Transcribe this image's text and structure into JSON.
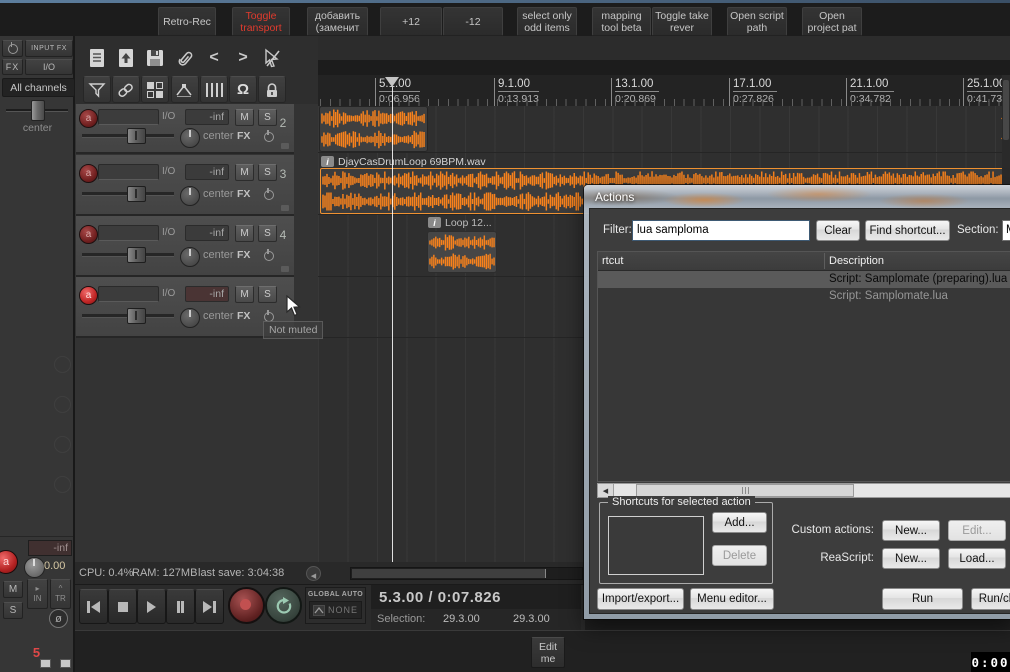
{
  "top_toolbar": {
    "buttons": [
      {
        "label": "Retro-Rec"
      },
      {
        "label": "Toggle transport"
      },
      {
        "label": "добавить (заменит"
      },
      {
        "label": "+12"
      },
      {
        "label": "-12"
      },
      {
        "label": "select only odd items"
      },
      {
        "label": "mapping tool beta"
      },
      {
        "label": "Toggle take rever"
      },
      {
        "label": "Open script path"
      },
      {
        "label": "Open project pat"
      }
    ]
  },
  "icons": {
    "undo": "<",
    "redo": ">",
    "magnet": "Ω",
    "rec_arm": "a",
    "info_badge": "i",
    "scroll_left": "◀",
    "monitor_play": "▸",
    "track_mode_caret": "^",
    "phase": "ø"
  },
  "sidebar": {
    "input_fx": "INPUT FX",
    "fx": "FX",
    "io": "I/O",
    "all_channels": "All channels",
    "pan": "center",
    "master": {
      "vol": "-inf",
      "pan_val": "0.00",
      "mute": "M",
      "solo": "S",
      "monitor": "IN",
      "track_mode": "TR",
      "number": "5"
    }
  },
  "ruler": {
    "marks": [
      {
        "beat": "5.1.00",
        "time": "0:06.956"
      },
      {
        "beat": "9.1.00",
        "time": "0:13.913"
      },
      {
        "beat": "13.1.00",
        "time": "0:20.869"
      },
      {
        "beat": "17.1.00",
        "time": "0:27.826"
      },
      {
        "beat": "21.1.00",
        "time": "0:34.782"
      },
      {
        "beat": "25.1.00",
        "time": "0:41.739"
      }
    ]
  },
  "tracks": [
    {
      "number": "2",
      "io": "I/O",
      "vol": "-inf",
      "pan": "center",
      "mute": "M",
      "solo": "S",
      "fx": "FX"
    },
    {
      "number": "3",
      "io": "I/O",
      "vol": "-inf",
      "pan": "center",
      "mute": "M",
      "solo": "S",
      "fx": "FX"
    },
    {
      "number": "4",
      "io": "I/O",
      "vol": "-inf",
      "pan": "center",
      "mute": "M",
      "solo": "S",
      "fx": "FX"
    },
    {
      "number": "",
      "io": "I/O",
      "vol": "-inf",
      "pan": "center",
      "mute": "M",
      "solo": "S",
      "fx": "FX"
    }
  ],
  "arrange": {
    "item1_label": "DjayCasDrumLoop 69BPM.wav",
    "item2_label": "Loop 12...",
    "wave_color": "#f8821c",
    "selected_border": "#ef9232"
  },
  "tooltip": "Not muted",
  "actions": {
    "title": "Actions",
    "filter_label": "Filter:",
    "filter_value": "lua samploma",
    "clear": "Clear",
    "find_shortcut": "Find shortcut...",
    "section_label": "Section:",
    "section_value": "Ma",
    "col_shortcut": "rtcut",
    "col_description": "Description",
    "rows": [
      {
        "description": "Script: Samplomate (preparing).lua",
        "selected": true
      },
      {
        "description": "Script: Samplomate.lua",
        "selected": false
      }
    ],
    "group_title": "Shortcuts for selected action",
    "add": "Add...",
    "delete": "Delete",
    "custom_actions_label": "Custom actions:",
    "custom_new": "New...",
    "custom_edit": "Edit...",
    "reascript_label": "ReaScript:",
    "rs_new": "New...",
    "rs_load": "Load...",
    "import_export": "Import/export...",
    "menu_editor": "Menu editor...",
    "run": "Run",
    "run_close": "Run/cl"
  },
  "status": {
    "cpu": "CPU: 0.4%",
    "ram": "RAM: 127MB",
    "last_save": "last save: 3:04:38"
  },
  "transport": {
    "global_auto": "GLOBAL AUTO",
    "auto_mode": "NONE",
    "position": "5.3.00 / 0:07.826",
    "selection_label": "Selection:",
    "sel_start": "29.3.00",
    "sel_end": "29.3.00"
  },
  "bottom": {
    "edit_button": "Edit me",
    "timer": "0:00"
  }
}
